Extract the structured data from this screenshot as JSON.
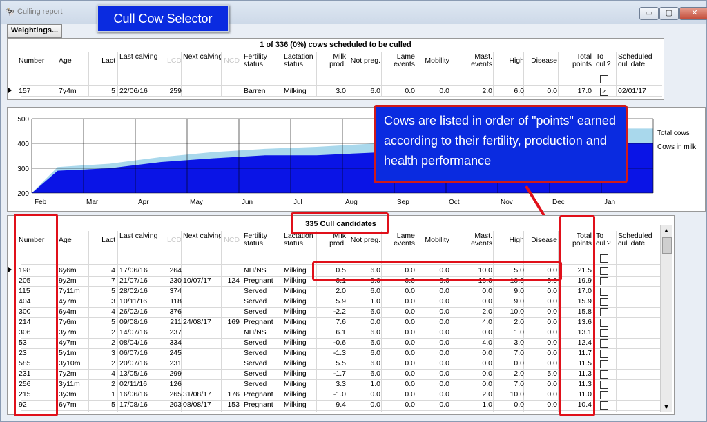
{
  "window": {
    "title": "Culling report",
    "minimize": "▭",
    "maximize": "▢",
    "close": "✕"
  },
  "callout_title": "Cull Cow Selector",
  "weightings_button": "Weightings...",
  "top_grid": {
    "title": "1 of 336 (0%) cows scheduled to be culled",
    "headers": [
      "Number",
      "Age",
      "Lact",
      "Last calving",
      "LCD",
      "Next calving",
      "NCD",
      "Fertility status",
      "Lactation status",
      "Milk prod.",
      "Not preg.",
      "Lame events",
      "Mobility",
      "Mast. events",
      "High",
      "Disease",
      "Total points",
      "To cull?",
      "Scheduled cull date"
    ],
    "rows": [
      [
        "157",
        "7y4m",
        "5",
        "22/06/16",
        "259",
        "",
        "",
        "Barren",
        "Milking",
        "3.0",
        "6.0",
        "0.0",
        "0.0",
        "2.0",
        "6.0",
        "0.0",
        "17.0",
        "checked",
        "02/01/17"
      ]
    ]
  },
  "chart_data": {
    "type": "area",
    "categories": [
      "Feb",
      "Mar",
      "Apr",
      "May",
      "Jun",
      "Jul",
      "Aug",
      "Sep",
      "Oct",
      "Nov",
      "Dec",
      "Jan"
    ],
    "ylim": [
      200,
      500
    ],
    "yticks": [
      500,
      400,
      300,
      200
    ],
    "series": [
      {
        "name": "Total cows",
        "color": "#a9d8ec",
        "values": [
          305,
          318,
          345,
          365,
          378,
          386,
          398,
          415,
          430,
          440,
          450,
          460
        ]
      },
      {
        "name": "Cows in milk",
        "color": "#0a14e6",
        "values": [
          290,
          300,
          325,
          340,
          352,
          352,
          362,
          372,
          380,
          390,
          395,
          400
        ]
      }
    ],
    "grid": true,
    "legend": "right"
  },
  "annotation": "Cows are listed in order of \"points\" earned according to their fertility, production and health performance",
  "bottom_grid": {
    "title": "335 Cull candidates",
    "rows": [
      [
        "198",
        "6y6m",
        "4",
        "17/06/16",
        "264",
        "",
        "",
        "NH/NS",
        "Milking",
        "0.5",
        "6.0",
        "0.0",
        "0.0",
        "10.0",
        "5.0",
        "0.0",
        "21.5"
      ],
      [
        "205",
        "9y2m",
        "7",
        "21/07/16",
        "230",
        "10/07/17",
        "124",
        "Pregnant",
        "Milking",
        "-0.1",
        "0.0",
        "0.0",
        "0.0",
        "10.0",
        "10.0",
        "0.0",
        "19.9"
      ],
      [
        "115",
        "7y11m",
        "5",
        "28/02/16",
        "374",
        "",
        "",
        "Served",
        "Milking",
        "2.0",
        "6.0",
        "0.0",
        "0.0",
        "0.0",
        "9.0",
        "0.0",
        "17.0"
      ],
      [
        "404",
        "4y7m",
        "3",
        "10/11/16",
        "118",
        "",
        "",
        "Served",
        "Milking",
        "5.9",
        "1.0",
        "0.0",
        "0.0",
        "0.0",
        "9.0",
        "0.0",
        "15.9"
      ],
      [
        "300",
        "6y4m",
        "4",
        "26/02/16",
        "376",
        "",
        "",
        "Served",
        "Milking",
        "-2.2",
        "6.0",
        "0.0",
        "0.0",
        "2.0",
        "10.0",
        "0.0",
        "15.8"
      ],
      [
        "214",
        "7y6m",
        "5",
        "09/08/16",
        "211",
        "24/08/17",
        "169",
        "Pregnant",
        "Milking",
        "7.6",
        "0.0",
        "0.0",
        "0.0",
        "4.0",
        "2.0",
        "0.0",
        "13.6"
      ],
      [
        "306",
        "3y7m",
        "2",
        "14/07/16",
        "237",
        "",
        "",
        "NH/NS",
        "Milking",
        "6.1",
        "6.0",
        "0.0",
        "0.0",
        "0.0",
        "1.0",
        "0.0",
        "13.1"
      ],
      [
        "53",
        "4y7m",
        "2",
        "08/04/16",
        "334",
        "",
        "",
        "Served",
        "Milking",
        "-0.6",
        "6.0",
        "0.0",
        "0.0",
        "4.0",
        "3.0",
        "0.0",
        "12.4"
      ],
      [
        "23",
        "5y1m",
        "3",
        "06/07/16",
        "245",
        "",
        "",
        "Served",
        "Milking",
        "-1.3",
        "6.0",
        "0.0",
        "0.0",
        "0.0",
        "7.0",
        "0.0",
        "11.7"
      ],
      [
        "585",
        "3y10m",
        "2",
        "20/07/16",
        "231",
        "",
        "",
        "Served",
        "Milking",
        "5.5",
        "6.0",
        "0.0",
        "0.0",
        "0.0",
        "0.0",
        "0.0",
        "11.5"
      ],
      [
        "231",
        "7y2m",
        "4",
        "13/05/16",
        "299",
        "",
        "",
        "Served",
        "Milking",
        "-1.7",
        "6.0",
        "0.0",
        "0.0",
        "0.0",
        "2.0",
        "5.0",
        "11.3"
      ],
      [
        "256",
        "3y11m",
        "2",
        "02/11/16",
        "126",
        "",
        "",
        "Served",
        "Milking",
        "3.3",
        "1.0",
        "0.0",
        "0.0",
        "0.0",
        "7.0",
        "0.0",
        "11.3"
      ],
      [
        "215",
        "3y3m",
        "1",
        "16/06/16",
        "265",
        "31/08/17",
        "176",
        "Pregnant",
        "Milking",
        "-1.0",
        "0.0",
        "0.0",
        "0.0",
        "2.0",
        "10.0",
        "0.0",
        "11.0"
      ],
      [
        "92",
        "6y7m",
        "5",
        "17/08/16",
        "203",
        "08/08/17",
        "153",
        "Pregnant",
        "Milking",
        "9.4",
        "0.0",
        "0.0",
        "0.0",
        "1.0",
        "0.0",
        "0.0",
        "10.4"
      ]
    ]
  }
}
